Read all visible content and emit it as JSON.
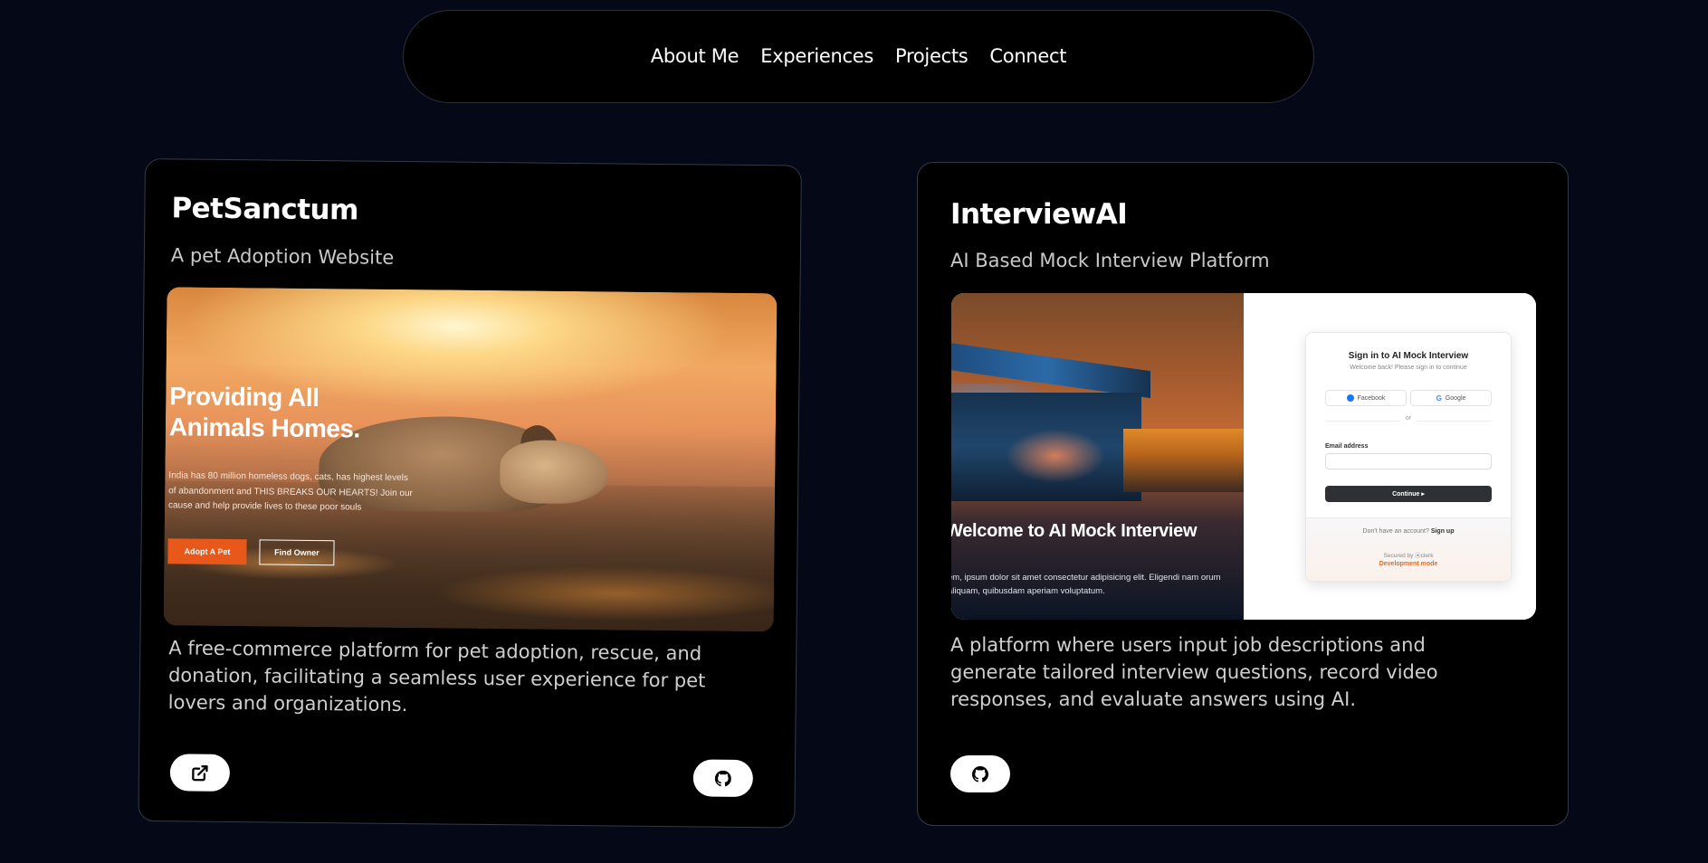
{
  "nav": {
    "items": [
      "About Me",
      "Experiences",
      "Projects",
      "Connect"
    ]
  },
  "projects": [
    {
      "title": "PetSanctum",
      "subtitle": "A pet Adoption Website",
      "description": "A free-commerce platform for pet adoption, rescue, and donation, facilitating a seamless user experience for pet lovers and organizations.",
      "preview": {
        "heading": "Providing All\nAnimals Homes.",
        "text": "India has 80 million homeless dogs, cats, has highest levels of abandonment and THIS BREAKS OUR HEARTS! Join our cause and help provide lives to these poor souls",
        "primary_button": "Adopt A Pet",
        "secondary_button": "Find Owner"
      },
      "icons": [
        "external-link-icon",
        "github-icon"
      ]
    },
    {
      "title": "InterviewAI",
      "subtitle": "AI Based Mock Interview Platform",
      "description": "A platform where users input job descriptions and generate tailored interview questions, record video responses, and evaluate answers using AI.",
      "preview": {
        "heading": "Welcome to AI Mock Interview",
        "text": "em, ipsum dolor sit amet consectetur adipisicing elit. Eligendi nam orum aliquam, quibusdam aperiam voluptatum.",
        "signin_title": "Sign in to AI Mock Interview",
        "signin_subtitle": "Welcome back! Please sign in to continue",
        "facebook_label": "Facebook",
        "google_label": "Google",
        "or_label": "or",
        "email_label": "Email address",
        "continue_label": "Continue ▸",
        "no_account_text": "Don't have an account?",
        "signup_label": "Sign up",
        "secured_text": "Secured by ⦿clerk",
        "dev_mode_text": "Development mode"
      },
      "icons": [
        "github-icon"
      ]
    }
  ],
  "colors": {
    "background": "#050816",
    "card": "#000000",
    "adopt_button": "#e8581a"
  }
}
